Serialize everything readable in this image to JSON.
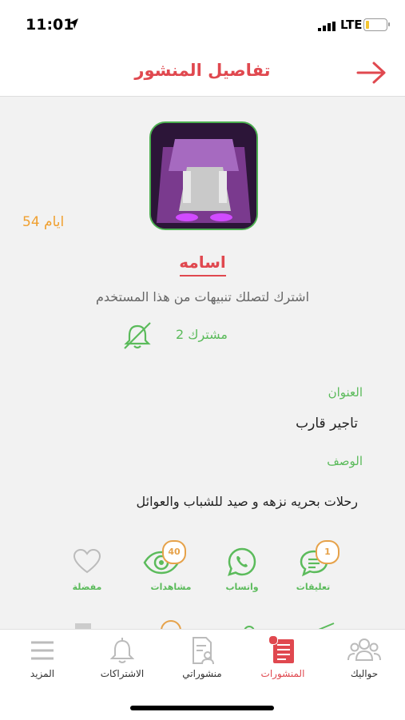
{
  "status_bar": {
    "time": "11:01",
    "network": "LTE"
  },
  "header": {
    "title": "تفاصيل المنشور"
  },
  "post": {
    "age": "54 ايام",
    "username": "اسامه",
    "subscribe_hint": "اشترك لتصلك تنبيهات من هذا المستخدم",
    "subscribers": "2 مشترك",
    "address_label": "العنوان",
    "address_value": "تاجير قارب",
    "description_label": "الوصف",
    "description_value": "رحلات بحريه نزهه و صيد للشباب والعوائل"
  },
  "actions": [
    {
      "label": "تعليقات",
      "count": "1",
      "icon": "comment-icon"
    },
    {
      "label": "واتساب",
      "icon": "whatsapp-icon"
    },
    {
      "label": "مشاهدات",
      "count": "40",
      "icon": "eye-icon"
    },
    {
      "label": "مفضلة",
      "icon": "heart-icon"
    }
  ],
  "tabs": [
    {
      "label": "حواليك",
      "icon": "people-icon"
    },
    {
      "label": "المنشورات",
      "icon": "posts-icon",
      "active": true
    },
    {
      "label": "منشوراتي",
      "icon": "my-posts-icon"
    },
    {
      "label": "الاشتراكات",
      "icon": "bell-icon"
    },
    {
      "label": "المزيد",
      "icon": "menu-icon"
    }
  ],
  "colors": {
    "accent": "#e0484f",
    "green": "#5bbb5b",
    "orange": "#f0a030"
  }
}
